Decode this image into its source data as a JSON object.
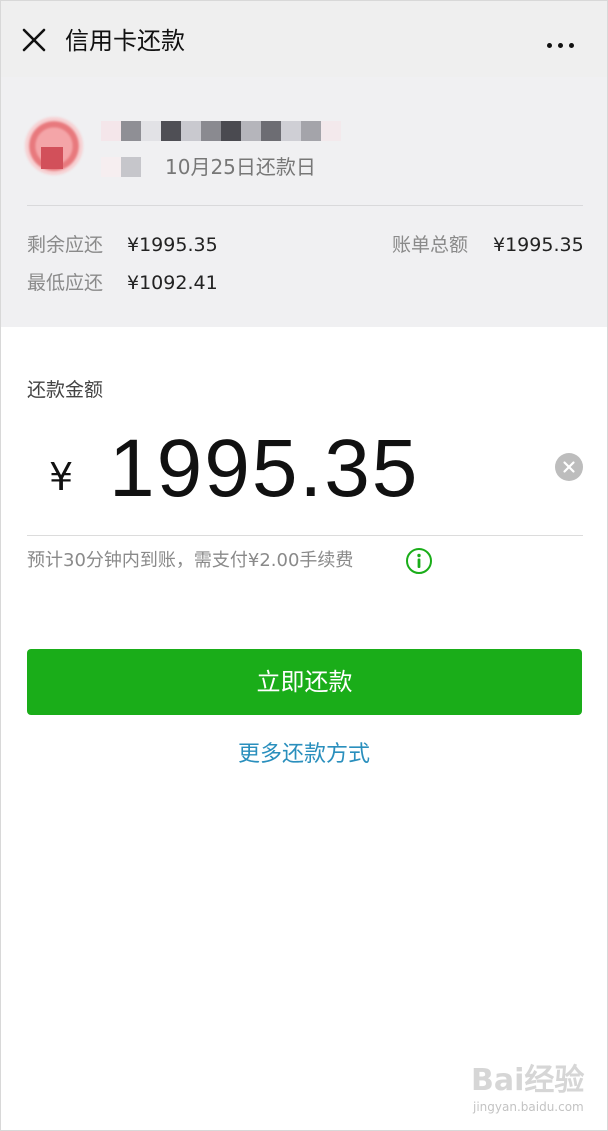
{
  "header": {
    "title": "信用卡还款",
    "close_icon": "close-icon",
    "more_icon": "more-dots-icon"
  },
  "card": {
    "due_text": "10月25日还款日",
    "remaining_label": "剩余应还",
    "remaining_value": "¥1995.35",
    "total_label": "账单总额",
    "total_value": "¥1995.35",
    "minimum_label": "最低应还",
    "minimum_value": "¥1092.41"
  },
  "payment": {
    "label": "还款金额",
    "currency": "¥",
    "amount": "1995.35",
    "fee_note": "预计30分钟内到账，需支付¥2.00手续费",
    "pay_button": "立即还款",
    "more_methods": "更多还款方式"
  },
  "colors": {
    "primary_green": "#1aad19",
    "link_blue": "#2a8fbd",
    "header_bg": "#efefef",
    "card_bg": "#f0f0f2"
  },
  "watermark": {
    "brand": "Bai经验",
    "url": "jingyan.baidu.com"
  }
}
